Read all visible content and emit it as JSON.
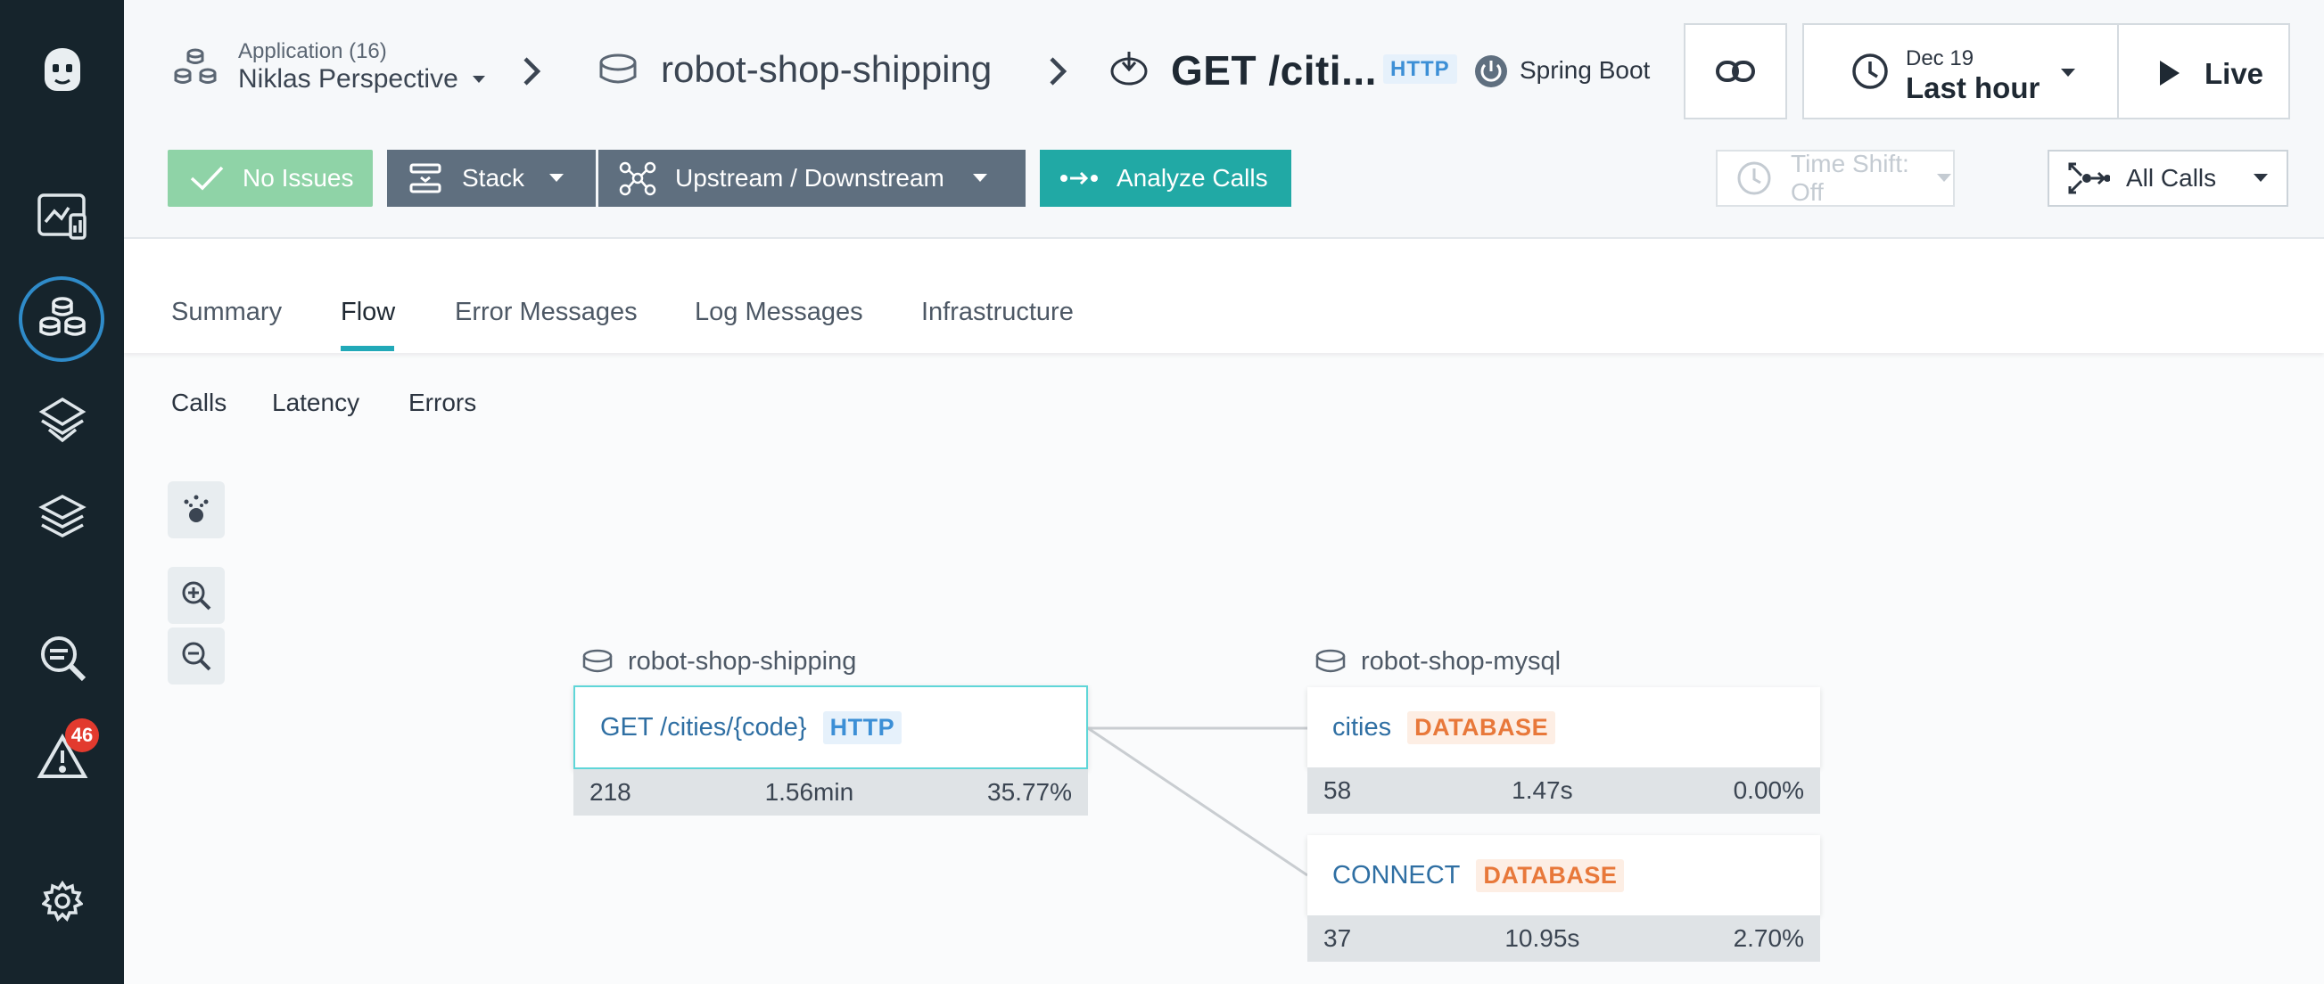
{
  "sidebar": {
    "alerts_badge": "46"
  },
  "header": {
    "app_label": "Application (16)",
    "app_value": "Niklas Perspective",
    "service": "robot-shop-shipping",
    "endpoint": "GET /citi...",
    "protocol": "HTTP",
    "technology": "Spring Boot",
    "time_date": "Dec 19",
    "time_range": "Last hour",
    "live_label": "Live"
  },
  "toolbar": {
    "issues_label": "No Issues",
    "stack_label": "Stack",
    "upstream_label": "Upstream / Downstream",
    "analyze_label": "Analyze Calls",
    "time_shift_label": "Time Shift: Off",
    "calls_filter_label": "All Calls"
  },
  "tabs": [
    {
      "label": "Summary"
    },
    {
      "label": "Flow",
      "active": true
    },
    {
      "label": "Error Messages"
    },
    {
      "label": "Log Messages"
    },
    {
      "label": "Infrastructure"
    }
  ],
  "subtabs": [
    {
      "label": "Calls"
    },
    {
      "label": "Latency"
    },
    {
      "label": "Errors"
    }
  ],
  "flow": {
    "source": {
      "service": "robot-shop-shipping",
      "endpoint": "GET /cities/{code}",
      "type": "HTTP",
      "calls": "218",
      "latency": "1.56min",
      "error_rate": "35.77%"
    },
    "target_service": "robot-shop-mysql",
    "targets": [
      {
        "endpoint": "cities",
        "type": "DATABASE",
        "calls": "58",
        "latency": "1.47s",
        "error_rate": "0.00%"
      },
      {
        "endpoint": "CONNECT",
        "type": "DATABASE",
        "calls": "37",
        "latency": "10.95s",
        "error_rate": "2.70%"
      }
    ]
  },
  "colors": {
    "sidebar": "#16242c",
    "accent_teal": "#21a9a5",
    "success": "#8fd3a7",
    "http_badge": "#3c8fd6",
    "database_badge": "#e8783a",
    "alert_badge": "#e23a2e"
  }
}
